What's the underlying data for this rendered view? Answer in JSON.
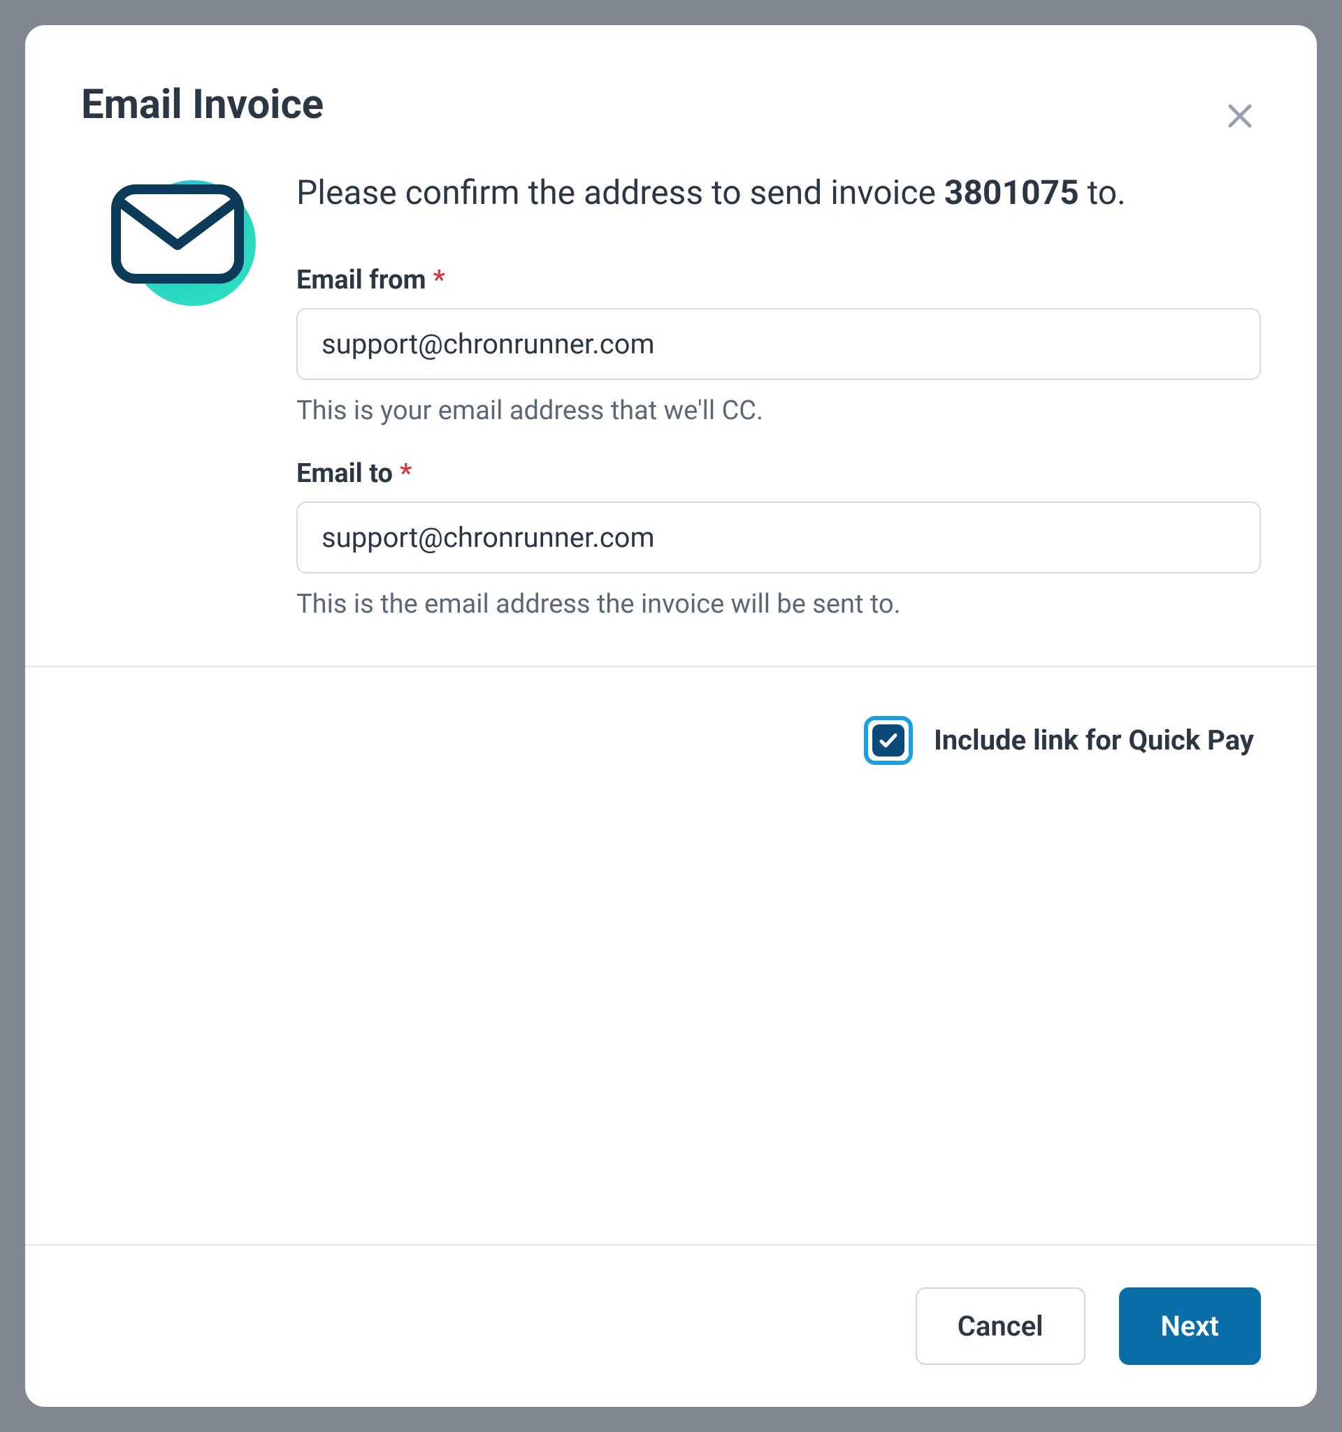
{
  "modal": {
    "title": "Email Invoice",
    "intro_prefix": "Please confirm the address to send invoice ",
    "invoice_number": "3801075",
    "intro_suffix": " to."
  },
  "fields": {
    "email_from": {
      "label": "Email from",
      "value": "support@chronrunner.com",
      "help": "This is your email address that we'll CC."
    },
    "email_to": {
      "label": "Email to",
      "value": "support@chronrunner.com",
      "help": "This is the email address the invoice will be sent to."
    }
  },
  "quickpay": {
    "label": "Include link for Quick Pay",
    "checked": true
  },
  "footer": {
    "cancel": "Cancel",
    "next": "Next"
  },
  "required_marker": "*"
}
